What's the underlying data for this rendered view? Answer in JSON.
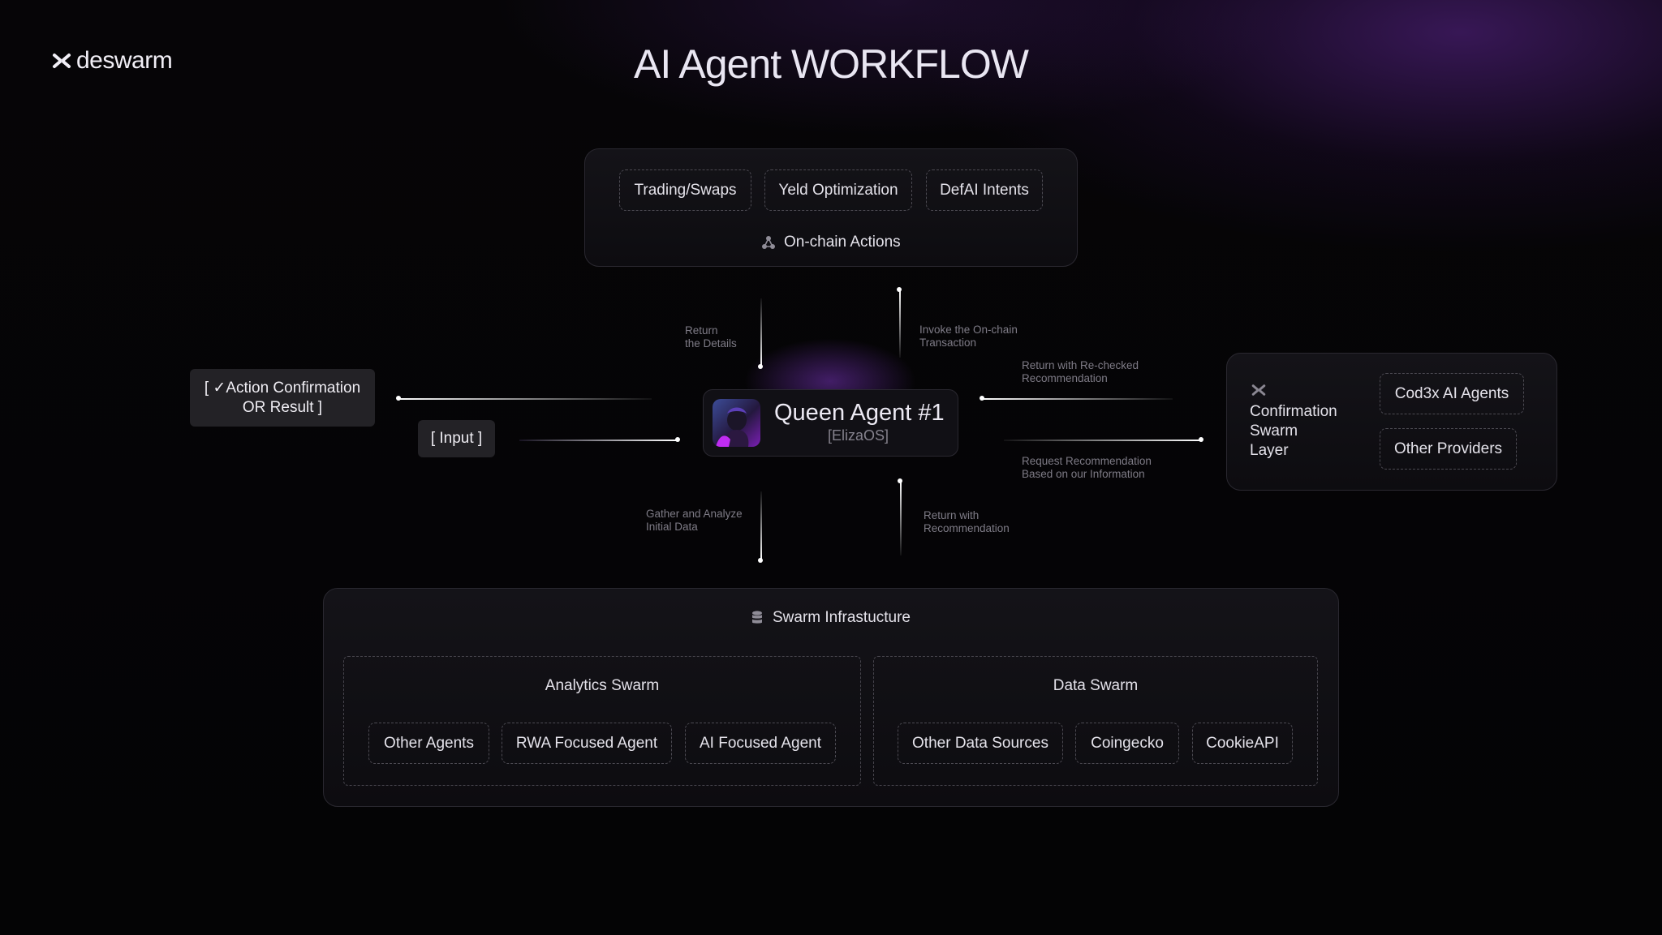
{
  "brand": {
    "logo_text": "deswarm",
    "logo_icon": "swarm-mark-icon"
  },
  "title": "AI Agent WORKFLOW",
  "onchain": {
    "actions": [
      "Trading/Swaps",
      "Yeld Optimization",
      "DefAI Intents"
    ],
    "label": "On-chain Actions",
    "icon": "network-icon"
  },
  "queen": {
    "name": "Queen Agent #1",
    "subtitle": "[ElizaOS]",
    "avatar": "agent-avatar"
  },
  "io": {
    "output": "[ ✓Action Confirmation\nOR Result ]",
    "input": "[ Input ]"
  },
  "flows": {
    "return_details": "Return\nthe Details",
    "invoke_tx": "Invoke the On-chain\nTransaction",
    "return_rechecked": "Return with Re-checked\nRecommendation",
    "request_reco": "Request Recommendation\nBased on our Information",
    "gather_analyze": "Gather and Analyze\nInitial Data",
    "return_reco": "Return with\nRecommendation"
  },
  "confirmation": {
    "label": "Confirmation\nSwarm\nLayer",
    "icon": "swarm-mark-icon",
    "providers": [
      "Cod3x AI Agents",
      "Other Providers"
    ]
  },
  "infrastructure": {
    "title": "Swarm Infrastucture",
    "icon": "database-icon",
    "analytics": {
      "title": "Analytics Swarm",
      "items": [
        "Other Agents",
        "RWA Focused Agent",
        "AI Focused Agent"
      ]
    },
    "data": {
      "title": "Data Swarm",
      "items": [
        "Other Data Sources",
        "Coingecko",
        "CookieAPI"
      ]
    }
  },
  "colors": {
    "background": "#050506",
    "accent_purple": "#7b2fd0",
    "panel": "#121116",
    "dashed_border": "#4c4a52"
  }
}
